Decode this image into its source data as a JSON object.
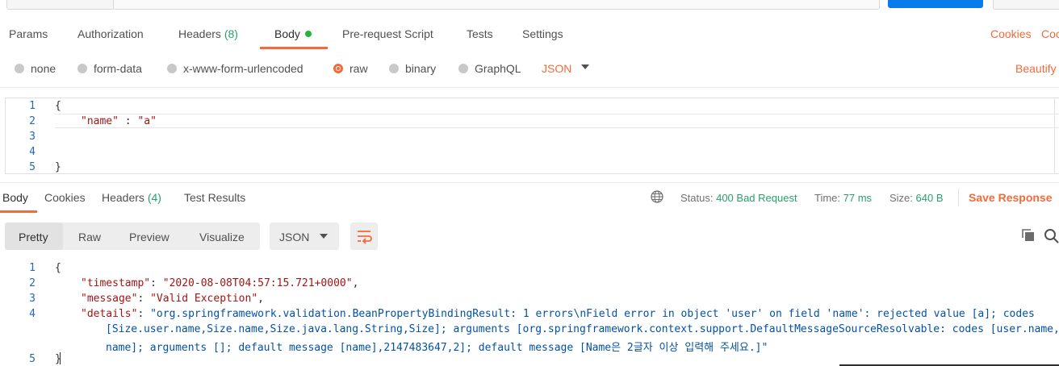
{
  "request_tabs": {
    "params": "Params",
    "authorization": "Authorization",
    "headers": "Headers",
    "headers_count": "(8)",
    "body": "Body",
    "pre_request": "Pre-request Script",
    "tests": "Tests",
    "settings": "Settings",
    "cookies": "Cookies",
    "code": "Coc"
  },
  "body_types": {
    "none": "none",
    "form_data": "form-data",
    "urlencoded": "x-www-form-urlencoded",
    "raw": "raw",
    "binary": "binary",
    "graphql": "GraphQL",
    "format": "JSON",
    "beautify": "Beautify"
  },
  "request_body": {
    "line_numbers": [
      "1",
      "2",
      "3",
      "4",
      "5"
    ],
    "open_brace": "{",
    "key": "\"name\"",
    "colon": " : ",
    "value": "\"a\"",
    "close_brace": "}"
  },
  "response_tabs": {
    "body": "Body",
    "cookies": "Cookies",
    "headers": "Headers",
    "headers_count": "(4)",
    "test_results": "Test Results"
  },
  "response_status": {
    "status_label": "Status:",
    "status_value": "400 Bad Request",
    "time_label": "Time:",
    "time_value": "77 ms",
    "size_label": "Size:",
    "size_value": "640 B",
    "save_response": "Save Response"
  },
  "response_views": {
    "pretty": "Pretty",
    "raw": "Raw",
    "preview": "Preview",
    "visualize": "Visualize",
    "format": "JSON"
  },
  "response_body": {
    "line_numbers": [
      "1",
      "2",
      "3",
      "4",
      "5"
    ],
    "open_brace": "{",
    "timestamp_key": "\"timestamp\"",
    "timestamp_value": "\"2020-08-08T04:57:15.721+0000\"",
    "message_key": "\"message\"",
    "message_value": "\"Valid Exception\"",
    "details_key": "\"details\"",
    "details_value_1": "\"org.springframework.validation.BeanPropertyBindingResult: 1 errors\\nField error in object 'user' on field 'name': rejected value [a]; codes",
    "details_value_2": "[Size.user.name,Size.name,Size.java.lang.String,Size]; arguments [org.springframework.context.support.DefaultMessageSourceResolvable: codes [user.name,",
    "details_value_3": "name]; arguments []; default message [name],2147483647,2]; default message [Name은 2글자 이상 입력해 주세요.]\"",
    "close_brace": "}"
  },
  "colors": {
    "accent": "#f26b3a",
    "success": "#26a269",
    "primary": "#097bed"
  },
  "icons": {
    "globe": "globe-icon",
    "wrap": "wrap-lines-icon",
    "copy": "copy-icon",
    "search": "search-icon",
    "caret": "chevron-down-icon"
  }
}
